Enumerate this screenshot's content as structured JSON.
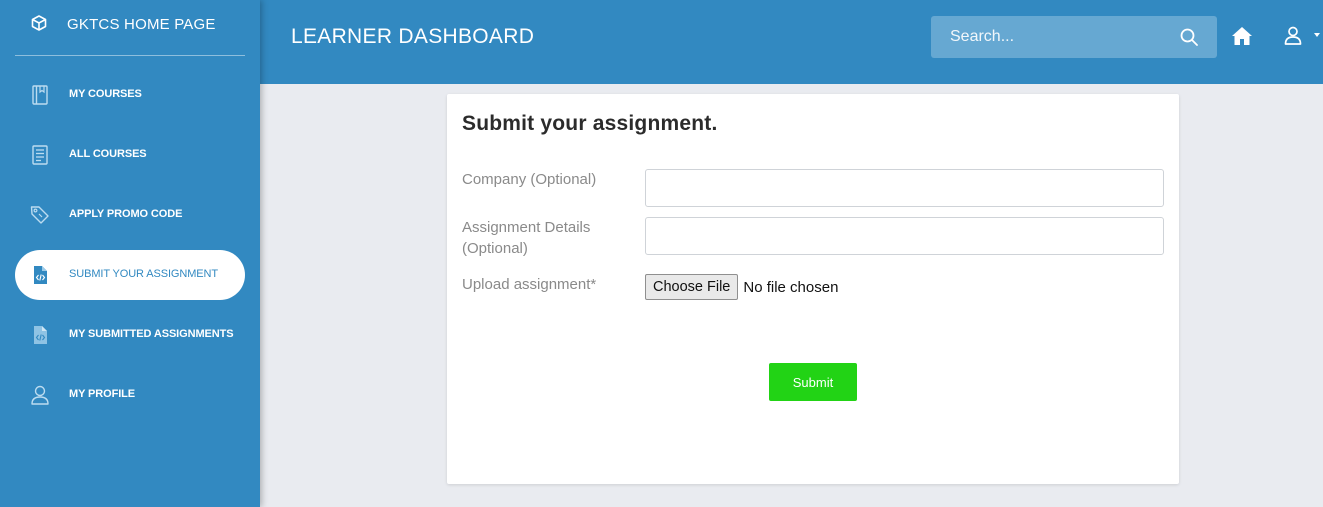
{
  "sidebar": {
    "brand": {
      "label": "GKTCS HOME PAGE",
      "icon": "cube-icon"
    },
    "items": [
      {
        "label": "MY COURSES",
        "icon": "book-icon",
        "active": false
      },
      {
        "label": "ALL COURSES",
        "icon": "notebook-icon",
        "active": false
      },
      {
        "label": "APPLY PROMO CODE",
        "icon": "tags-icon",
        "active": false
      },
      {
        "label": "SUBMIT YOUR ASSIGNMENT",
        "icon": "file-code-icon",
        "active": true
      },
      {
        "label": "MY SUBMITTED ASSIGNMENTS",
        "icon": "file-code-icon",
        "active": false
      },
      {
        "label": "MY PROFILE",
        "icon": "user-icon",
        "active": false
      }
    ]
  },
  "header": {
    "title": "LEARNER DASHBOARD",
    "search": {
      "placeholder": "Search...",
      "value": ""
    },
    "icons": [
      "search-icon",
      "home-icon",
      "user-icon",
      "caret-down-icon"
    ]
  },
  "form": {
    "title": "Submit your assignment.",
    "company_label": "Company (Optional)",
    "company_value": "",
    "details_label": "Assignment Details (Optional)",
    "details_value": "",
    "upload_label": "Upload assignment*",
    "file_button_label": "Choose File",
    "file_status": "No file chosen",
    "submit_label": "Submit"
  },
  "colors": {
    "primary": "#3289c1",
    "background": "#e9ebf0",
    "search_bg": "#66a8d2",
    "submit": "#22d315",
    "title_text": "#2b2b2b",
    "label_text": "#8a8a8a"
  }
}
